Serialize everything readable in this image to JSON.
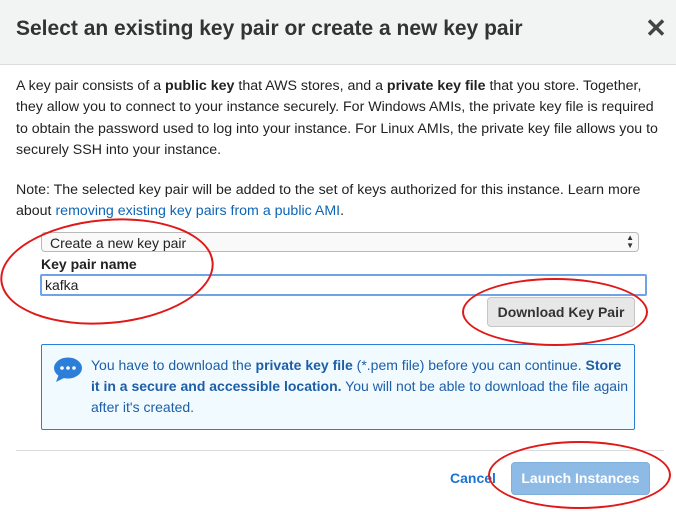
{
  "dialog": {
    "title": "Select an existing key pair or create a new key pair",
    "close_symbol": "✕"
  },
  "intro": {
    "t1": "A key pair consists of a ",
    "b1": "public key",
    "t2": " that AWS stores, and a ",
    "b2": "private key file",
    "t3": " that you store. Together, they allow you to connect to your instance securely. For Windows AMIs, the private key file is required to obtain the password used to log into your instance. For Linux AMIs, the private key file allows you to securely SSH into your instance."
  },
  "note": {
    "text": "Note: The selected key pair will be added to the set of keys authorized for this instance. Learn more about ",
    "link": "removing existing key pairs from a public AMI",
    "end": "."
  },
  "key_pair_select": {
    "selected": "Create a new key pair"
  },
  "key_pair_name": {
    "label": "Key pair name",
    "value": "kafka"
  },
  "download_button": "Download Key Pair",
  "info_box": {
    "t1": "You have to download the ",
    "b1": "private key file",
    "t2": " (*.pem file) before you can continue. ",
    "b2": "Store it in a secure and accessible location.",
    "t3": " You will not be able to download the file again after it's created."
  },
  "footer": {
    "cancel": "Cancel",
    "launch": "Launch Instances"
  },
  "colors": {
    "link": "#0e65b6",
    "info_border": "#2b7fd8",
    "info_text": "#1d5ea7",
    "launch_button": "#8dbbe6",
    "annotation": "#e01818"
  },
  "icons": {
    "close": "close-icon",
    "info": "chat-bubble-icon",
    "select_arrows": "updown-arrows-icon"
  }
}
